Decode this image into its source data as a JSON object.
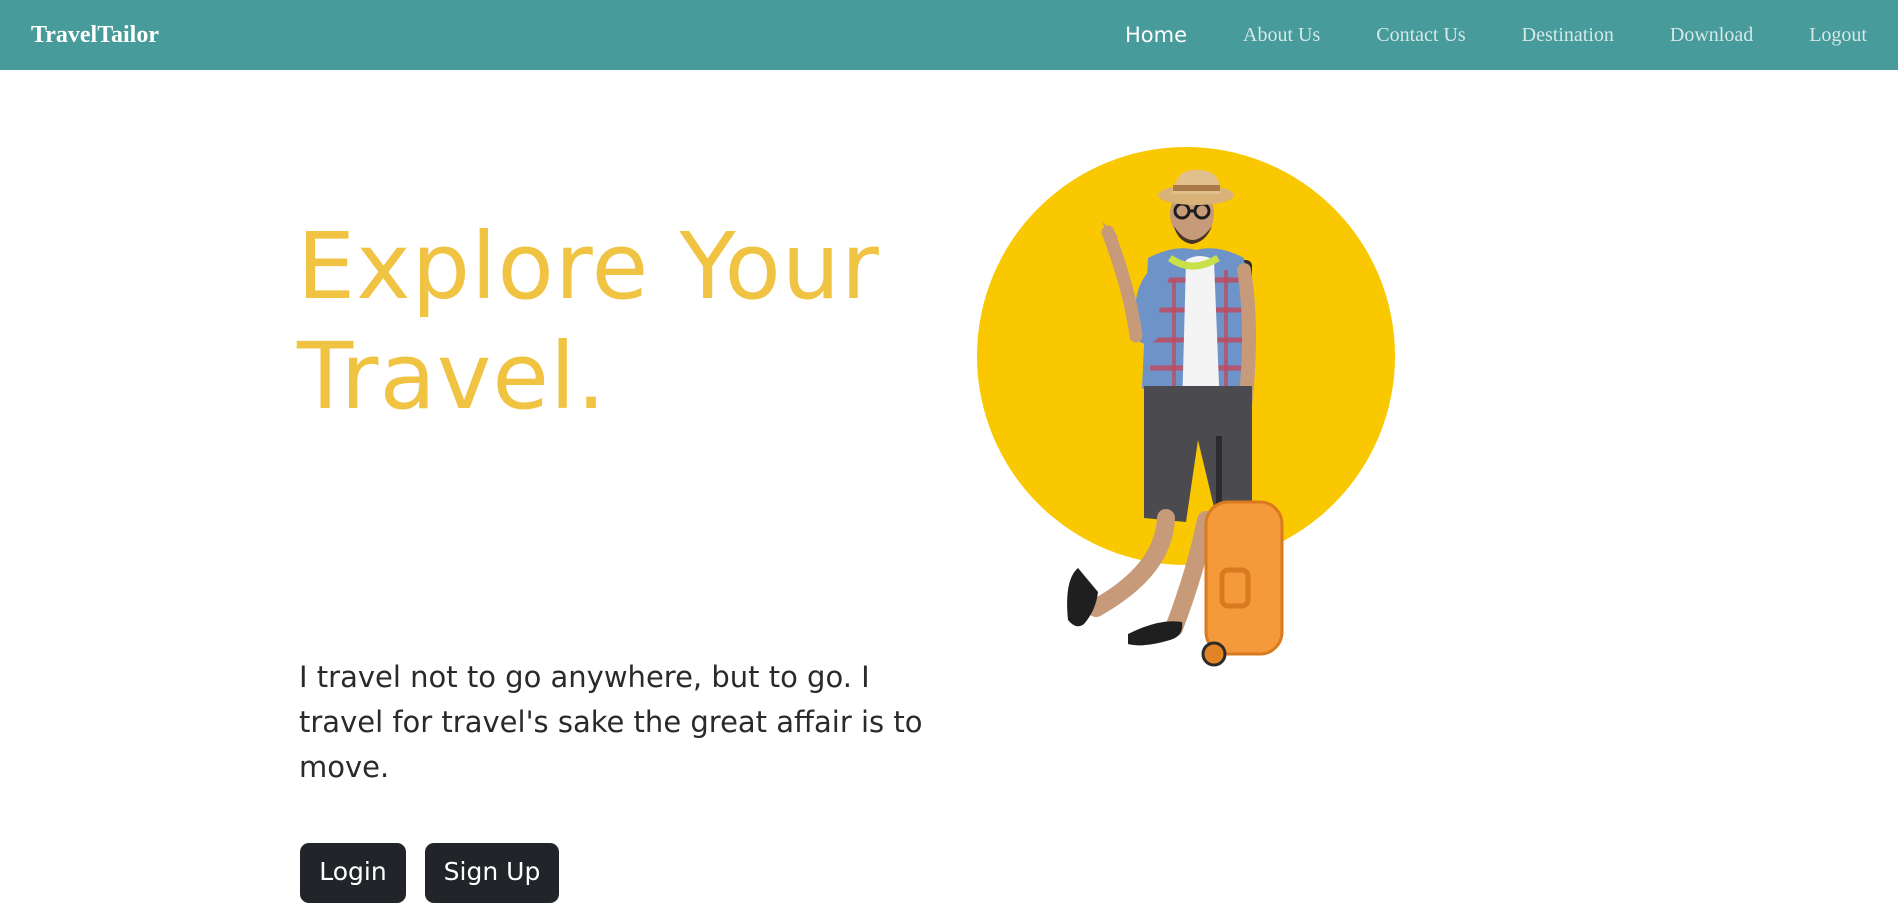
{
  "brand": "TravelTailor",
  "nav": {
    "items": [
      "Home",
      "About Us",
      "Contact Us",
      "Destination",
      "Download",
      "Logout"
    ],
    "active": "Home"
  },
  "hero": {
    "title_line1": "Explore Your",
    "title_line2": "Travel.",
    "quote": "I travel not to go anywhere, but to go. I travel for travel's sake the great affair is to move.",
    "login_label": "Login",
    "signup_label": "Sign Up",
    "image_description": "traveler with hat and suitcase over yellow circle"
  },
  "colors": {
    "navbar_bg": "#479b9a",
    "title_yellow": "#f1c343",
    "circle_yellow": "#fac800",
    "button_dark": "#212529",
    "suitcase_orange": "#f59a3a"
  }
}
